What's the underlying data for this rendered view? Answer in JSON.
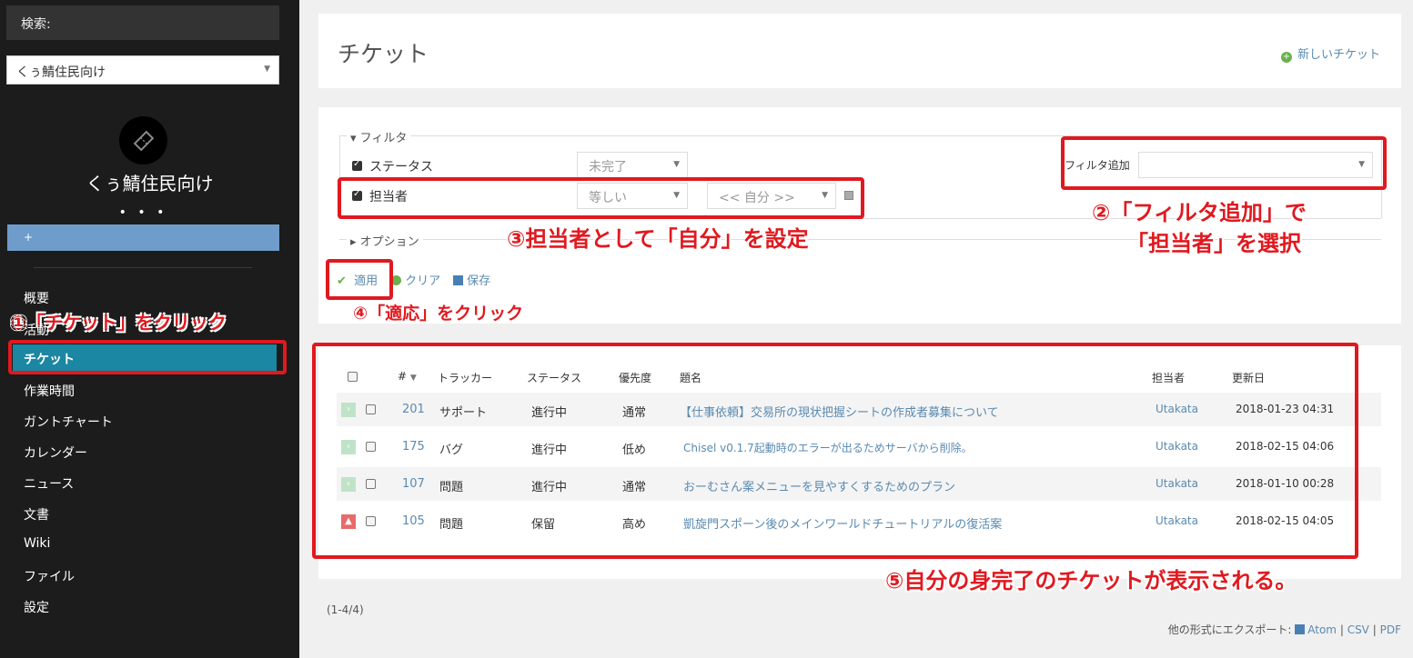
{
  "sidebar": {
    "search_label": "検索:",
    "project_select": "くぅ鯖住民向け",
    "project_name": "くぅ鯖住民向け",
    "more_dots": "• • •",
    "plus_label": "+",
    "nav": [
      "概要",
      "活動",
      "チケット",
      "作業時間",
      "ガントチャート",
      "カレンダー",
      "ニュース",
      "文書",
      "Wiki",
      "ファイル",
      "設定"
    ],
    "active": "チケット"
  },
  "header": {
    "title": "チケット",
    "new_ticket": "新しいチケット"
  },
  "filters": {
    "legend": "フィルタ",
    "rows": [
      {
        "label": "ステータス",
        "operator": "未完了"
      },
      {
        "label": "担当者",
        "operator": "等しい",
        "value": "<< 自分 >>"
      }
    ],
    "add_filter_label": "フィルタ追加",
    "options_legend": "オプション",
    "apply": "適用",
    "clear": "クリア",
    "save": "保存"
  },
  "table": {
    "headers": [
      "#",
      "トラッカー",
      "ステータス",
      "優先度",
      "題名",
      "担当者",
      "更新日"
    ],
    "rows": [
      {
        "id": "201",
        "tracker": "サポート",
        "status": "進行中",
        "priority": "通常",
        "subject": "【仕事依頼】交易所の現状把握シートの作成者募集について",
        "assignee": "Utakata",
        "updated": "2018-01-23 04:31"
      },
      {
        "id": "175",
        "tracker": "バグ",
        "status": "進行中",
        "priority": "低め",
        "subject": "Chisel v0.1.7起動時のエラーが出るためサーバから削除。",
        "assignee": "Utakata",
        "updated": "2018-02-15 04:06"
      },
      {
        "id": "107",
        "tracker": "問題",
        "status": "進行中",
        "priority": "通常",
        "subject": "おーむさん案メニューを見やすくするためのプラン",
        "assignee": "Utakata",
        "updated": "2018-01-10 00:28"
      },
      {
        "id": "105",
        "tracker": "問題",
        "status": "保留",
        "priority": "高め",
        "subject": "凱旋門スポーン後のメインワールドチュートリアルの復活案",
        "assignee": "Utakata",
        "updated": "2018-02-15 04:05"
      }
    ]
  },
  "pagination": "(1-4/4)",
  "export": {
    "label": "他の形式にエクスポート:",
    "atom": "Atom",
    "csv": "CSV",
    "pdf": "PDF",
    "sep": "|"
  },
  "annotations": {
    "a1": "①「チケット」をクリック",
    "a2_line1": "②「フィルタ追加」で",
    "a2_line2": "「担当者」を選択",
    "a3": "③担当者として「自分」を設定",
    "a4": "④「適応」をクリック",
    "a5": "⑤自分の身完了のチケットが表示される。"
  },
  "colors": {
    "sidebar": "#1c1c1c",
    "active": "#1b87a2",
    "accent": "#6e9ccb",
    "annotation": "#e0191f",
    "link": "#5a8ab0"
  }
}
